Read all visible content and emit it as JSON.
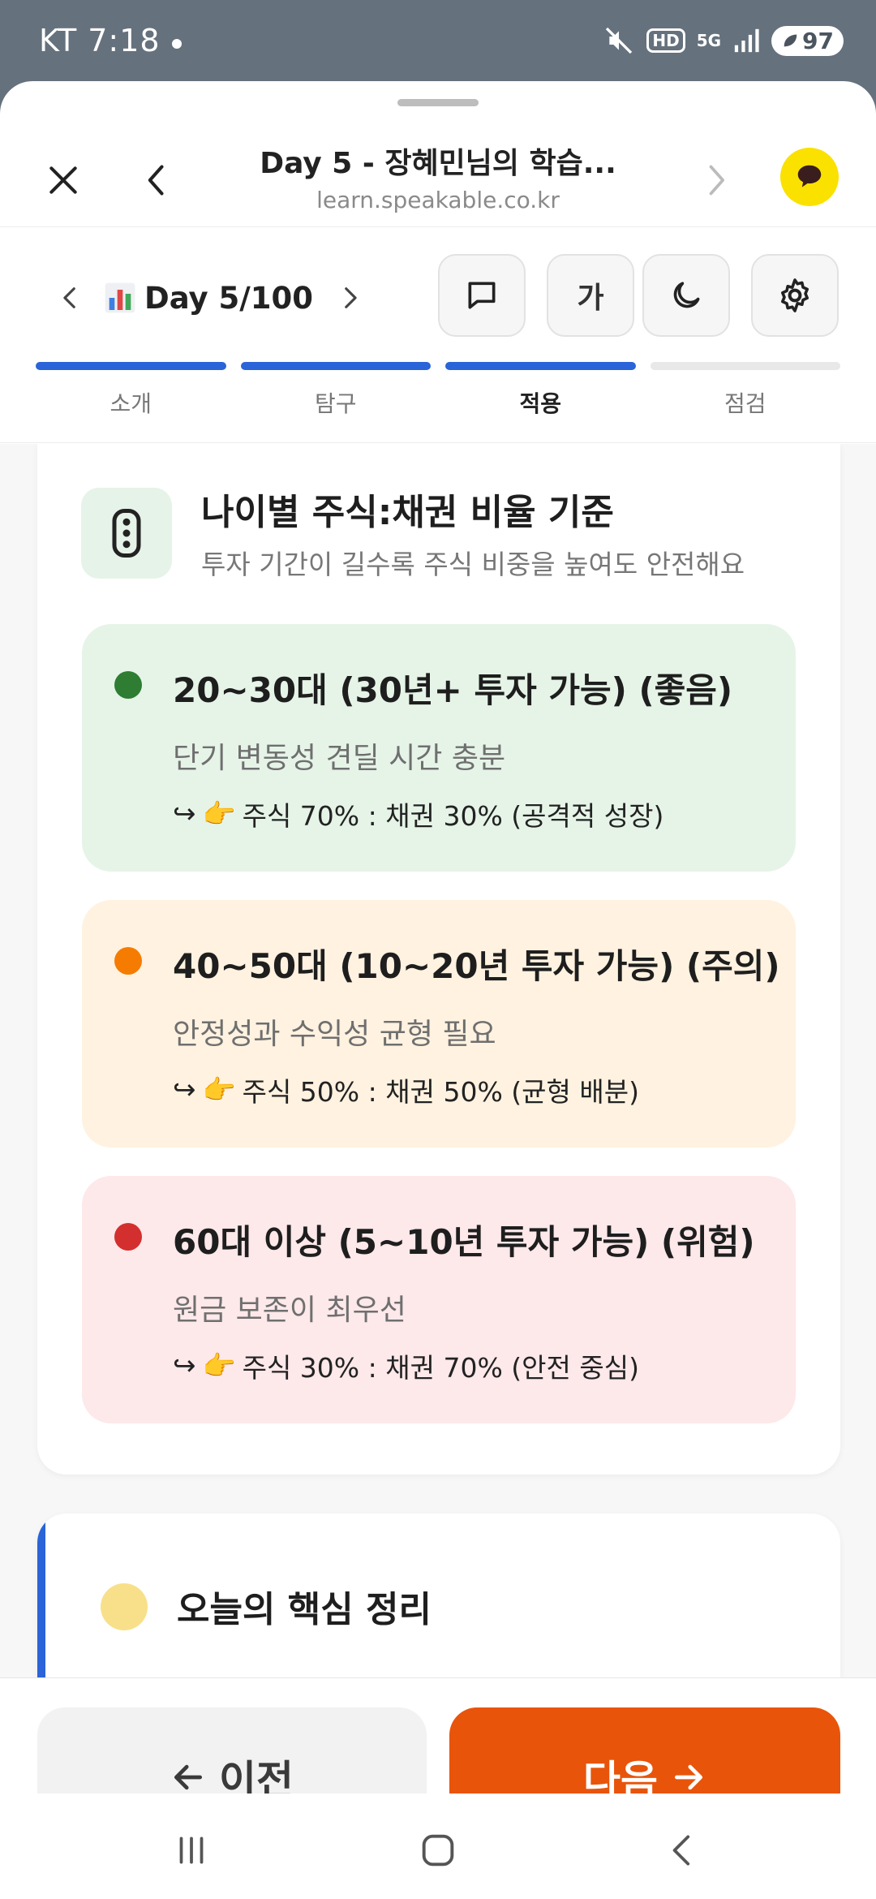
{
  "status": {
    "carrier": "KT 7:18",
    "network": "5G",
    "battery": "97",
    "hd": "HD"
  },
  "browser": {
    "title": "Day 5 - 장혜민님의 학습...",
    "url": "learn.speakable.co.kr"
  },
  "toolbar": {
    "day_label": "Day 5/100",
    "font_btn": "가"
  },
  "progress": {
    "steps": [
      {
        "label": "소개",
        "done": true
      },
      {
        "label": "탐구",
        "done": true
      },
      {
        "label": "적용",
        "done": true
      },
      {
        "label": "점검",
        "done": false
      }
    ],
    "active_step": "적용"
  },
  "card": {
    "title": "나이별 주식:채권 비율 기준",
    "subtitle": "투자 기간이 길수록 주식 비중을 높여도 안전해요",
    "items": [
      {
        "heading": "20~30대 (30년+ 투자 가능) (좋음)",
        "desc": "단기 변동성 견딜 시간 충분",
        "ratio": "주식 70% : 채권 30% (공격적 성장)",
        "bg": "#e6f4e8",
        "dot": "#2e7d32"
      },
      {
        "heading": "40~50대 (10~20년 투자 가능) (주의)",
        "desc": "안정성과 수익성 균형 필요",
        "ratio": "주식 50% : 채권 50% (균형 배분)",
        "bg": "#fff2e0",
        "dot": "#f57c00"
      },
      {
        "heading": "60대 이상 (5~10년 투자 가능) (위험)",
        "desc": "원금 보존이 최우선",
        "ratio": "주식 30% : 채권 70% (안전 중심)",
        "bg": "#fde8ea",
        "dot": "#d32f2f"
      }
    ]
  },
  "card2": {
    "title": "오늘의 핵심 정리"
  },
  "nav_buttons": {
    "prev": "이전",
    "next": "다음"
  },
  "colors": {
    "accent_blue": "#2a64d8",
    "next_orange": "#e8540a",
    "kakao_yellow": "#fae100"
  }
}
